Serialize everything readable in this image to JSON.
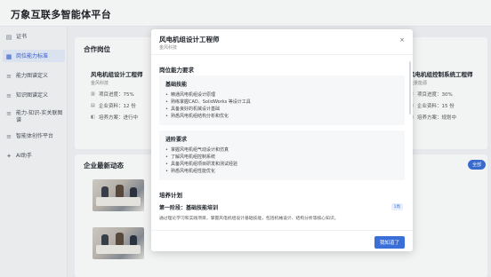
{
  "app": {
    "title": "万象互联多智能体平台"
  },
  "sidebar": {
    "items": [
      {
        "icon": "certificate-icon",
        "label": "证书"
      },
      {
        "icon": "grid-icon",
        "label": "岗位能力标准"
      },
      {
        "icon": "list-icon",
        "label": "能力图谱定义"
      },
      {
        "icon": "list-icon",
        "label": "知识图谱定义"
      },
      {
        "icon": "list-icon",
        "label": "能力-知识-实关联图谱"
      },
      {
        "icon": "list-icon",
        "label": "智能体创作平台"
      },
      {
        "icon": "ai-icon",
        "label": "AI助手"
      }
    ],
    "active_index": 1
  },
  "main": {
    "jobs_title": "合作岗位",
    "job_left": {
      "title": "风电机组设计工程师",
      "company": "金风科技",
      "progress_label": "项目进度：75%",
      "resources_label": "企业资料：12 份",
      "plan_label": "培养方案：进行中"
    },
    "job_right": {
      "title": "风电机组控制系统工程师",
      "company": "远景能源",
      "progress_label": "项目进度：30%",
      "resources_label": "企业资料：15 份",
      "plan_label": "培养方案：规划中"
    },
    "news_title": "企业最新动态",
    "news_all": "全部"
  },
  "modal": {
    "title": "风电机组设计工程师",
    "company": "金风科技",
    "close": "×",
    "requirements_title": "岗位能力要求",
    "basic": {
      "title": "基础技能",
      "items": [
        "精通风电机组设计原理",
        "熟练掌握CAD、SolidWorks 等设计工具",
        "具备良好的机械设计基础",
        "熟悉风电机组结构分析和优化"
      ]
    },
    "advanced": {
      "title": "进阶要求",
      "items": [
        "掌握风电机组气动设计和仿真",
        "了解风电机组控制系统",
        "具备风电机组项目研发和测试经验",
        "熟悉风电机组性能优化"
      ]
    },
    "training_title": "培养计划",
    "stage": {
      "title": "第一阶段：基础技能培训",
      "tag": "1周",
      "desc": "通过理论学习和实践项目，掌握风电机组设计基础技能，包括机械设计、结构分析等核心知识。"
    },
    "ok_label": "我知道了"
  }
}
